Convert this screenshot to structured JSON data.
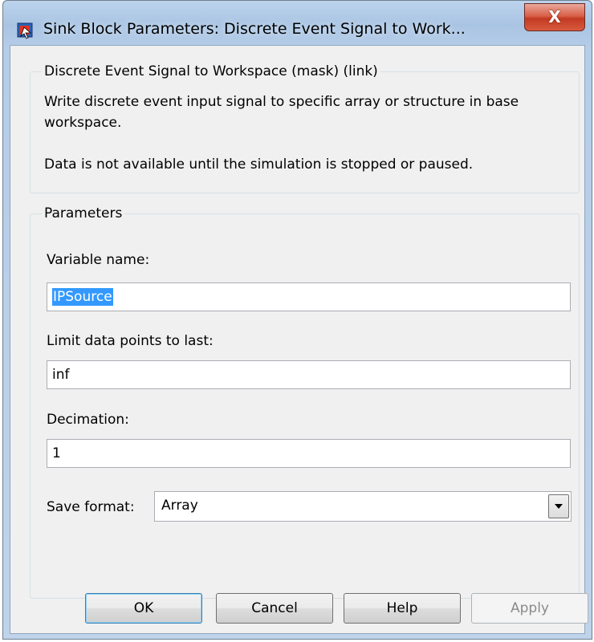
{
  "window": {
    "title": "Sink Block Parameters: Discrete Event Signal to Work...",
    "close_label": "X"
  },
  "description": {
    "group_title": "Discrete Event Signal to Workspace (mask) (link)",
    "line1": "Write discrete event input signal to specific array or structure in base",
    "line2": "workspace.",
    "line3": "Data is not available until the simulation is stopped or paused."
  },
  "parameters": {
    "group_title": "Parameters",
    "variable_name": {
      "label": "Variable name:",
      "value": "IPSource"
    },
    "limit_points": {
      "label": "Limit data points to last:",
      "value": "inf"
    },
    "decimation": {
      "label": "Decimation:",
      "value": "1"
    },
    "save_format": {
      "label": "Save format:",
      "value": "Array"
    }
  },
  "buttons": {
    "ok": "OK",
    "cancel": "Cancel",
    "help": "Help",
    "apply": "Apply"
  }
}
